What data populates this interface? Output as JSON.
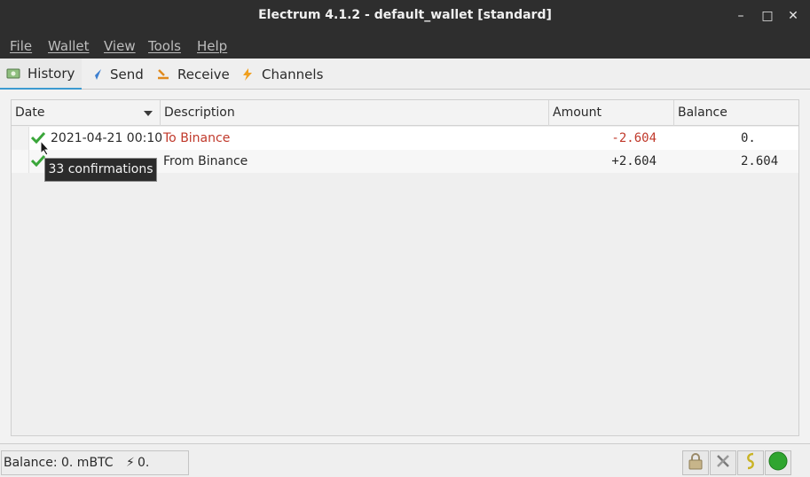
{
  "window": {
    "title": "Electrum 4.1.2  -  default_wallet  [standard]",
    "minimize_glyph": "–",
    "maximize_glyph": "□",
    "close_glyph": "✕"
  },
  "menu": [
    "File",
    "Wallet",
    "View",
    "Tools",
    "Help"
  ],
  "tabs": [
    {
      "label": "History",
      "icon": "history-icon",
      "active": true
    },
    {
      "label": "Send",
      "icon": "send-icon",
      "active": false
    },
    {
      "label": "Receive",
      "icon": "receive-icon",
      "active": false
    },
    {
      "label": "Channels",
      "icon": "lightning-icon",
      "active": false
    }
  ],
  "history": {
    "columns": [
      "Date",
      "Description",
      "Amount",
      "Balance"
    ],
    "rows": [
      {
        "status": "check-icon",
        "date": "2021-04-21 00:10",
        "description": "To Binance",
        "amount": "-2.604",
        "balance": "0."
      },
      {
        "status": "check-icon",
        "date": "",
        "description": "From Binance",
        "amount": "+2.604",
        "balance": "2.604"
      }
    ],
    "tooltip": "33 confirmations"
  },
  "status": {
    "balance": "Balance: 0. mBTC",
    "lightning_balance": "0. mBTC",
    "lightning_glyph": "⚡"
  },
  "colors": {
    "negative": "#c0392b",
    "check": "#3aa63a",
    "network_ok": "#2fa52f",
    "titlebar": "#2e2e2e"
  }
}
